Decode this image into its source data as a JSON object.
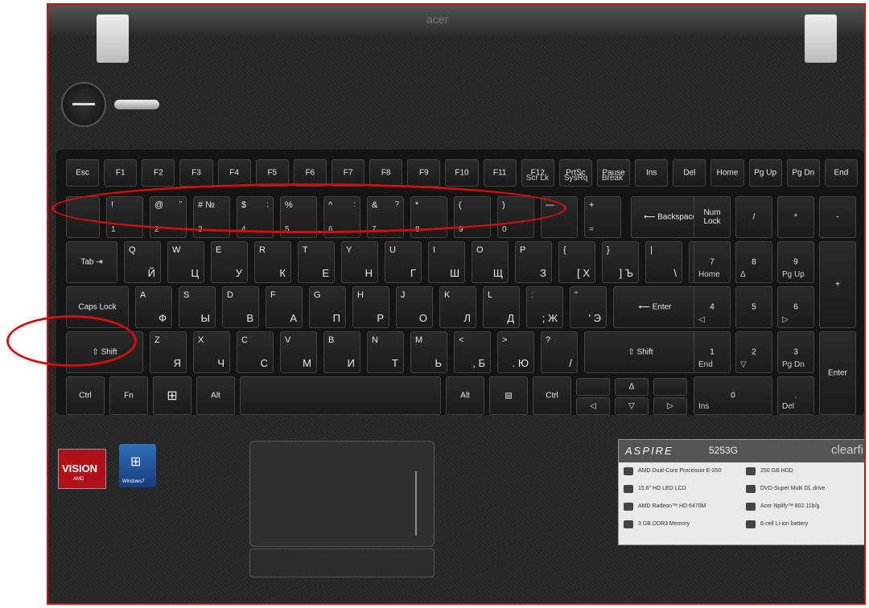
{
  "brand": "acer",
  "keyboard": {
    "fn_row": [
      "Esc",
      "F1",
      "F2",
      "F3",
      "F4",
      "F5",
      "F6",
      "F7",
      "F8",
      "F9",
      "F10",
      "F11",
      "F12",
      "PrtSc",
      "Pause",
      "Ins",
      "Del",
      "Home",
      "Pg Up",
      "Pg Dn",
      "End"
    ],
    "fn_sub": {
      "f12": "Scr Lk",
      "prtsc": "SysRq",
      "pause": "Break"
    },
    "num_row": [
      {
        "p": "!",
        "s": "1"
      },
      {
        "p": "@",
        "t": "\"",
        "s": "2"
      },
      {
        "p": "# №",
        "s": "3"
      },
      {
        "p": "$",
        "t": ";",
        "s": "4"
      },
      {
        "p": "%",
        "s": "5"
      },
      {
        "p": "^",
        "t": ":",
        "s": "6"
      },
      {
        "p": "&",
        "t": "?",
        "s": "7"
      },
      {
        "p": "*",
        "s": "8"
      },
      {
        "p": "(",
        "s": "9"
      },
      {
        "p": ")",
        "s": "0"
      },
      {
        "p": "—",
        "s": ""
      },
      {
        "p": "+",
        "s": "="
      }
    ],
    "backspace": "Backspace",
    "num_lock": "Num Lock",
    "row_q": [
      {
        "p": "Q",
        "c": "Й"
      },
      {
        "p": "W",
        "c": "Ц"
      },
      {
        "p": "E",
        "c": "У"
      },
      {
        "p": "R",
        "c": "К"
      },
      {
        "p": "T",
        "c": "Е"
      },
      {
        "p": "Y",
        "c": "Н"
      },
      {
        "p": "U",
        "c": "Г"
      },
      {
        "p": "I",
        "c": "Ш"
      },
      {
        "p": "O",
        "c": "Щ"
      },
      {
        "p": "P",
        "c": "З"
      },
      {
        "p": "{",
        "c": "[ Х"
      },
      {
        "p": "}",
        "c": "] Ъ"
      },
      {
        "p": "|",
        "c": "\\"
      },
      {
        "p": "/",
        "c": "\\"
      }
    ],
    "row_a": [
      {
        "p": "A",
        "c": "Ф"
      },
      {
        "p": "S",
        "c": "Ы"
      },
      {
        "p": "D",
        "c": "В"
      },
      {
        "p": "F",
        "c": "А"
      },
      {
        "p": "G",
        "c": "П"
      },
      {
        "p": "H",
        "c": "Р"
      },
      {
        "p": "J",
        "c": "О"
      },
      {
        "p": "K",
        "c": "Л"
      },
      {
        "p": "L",
        "c": "Д"
      },
      {
        "p": ":",
        "c": "; Ж"
      },
      {
        "p": "\"",
        "c": "' Э"
      }
    ],
    "row_z": [
      {
        "p": "Z",
        "c": "Я"
      },
      {
        "p": "X",
        "c": "Ч"
      },
      {
        "p": "C",
        "c": "С"
      },
      {
        "p": "V",
        "c": "М"
      },
      {
        "p": "B",
        "c": "И"
      },
      {
        "p": "N",
        "c": "Т"
      },
      {
        "p": "M",
        "c": "Ь"
      },
      {
        "p": "<",
        "c": ", Б"
      },
      {
        "p": ">",
        "c": ". Ю"
      },
      {
        "p": "?",
        "c": "/"
      }
    ],
    "tab": "Tab",
    "caps": "Caps Lock",
    "enter": "Enter",
    "shift_l": "⇧ Shift",
    "shift_r": "⇧ Shift",
    "ctrl": "Ctrl",
    "fn": "Fn",
    "alt": "Alt",
    "numpad": {
      "slash": "/",
      "star": "*",
      "minus": "-",
      "plus": "+",
      "n7": "7",
      "n7s": "Home",
      "n8": "8",
      "n8s": "Δ",
      "n9": "9",
      "n9s": "Pg Up",
      "n4": "4",
      "n4s": "◁",
      "n5": "5",
      "n6": "6",
      "n6s": "▷",
      "n1": "1",
      "n1s": "End",
      "n2": "2",
      "n2s": "▽",
      "n3": "3",
      "n3s": "Pg Dn",
      "n0": "0",
      "n0s": "Ins",
      "dot": ".",
      "dots": "Del",
      "enter": "Enter"
    },
    "arrows": {
      "up": "Δ",
      "left": "◁",
      "down": "▽",
      "right": "▷"
    }
  },
  "stickers": {
    "vision": "VISION",
    "vision_sub": "AMD",
    "windows": "Windows7",
    "aspire": "ASPIRE",
    "model": "5253G",
    "clear": "clearfi",
    "specs": [
      "AMD Dual-Core Processor E-350",
      "250 GB HDD",
      "15.6\" HD LED LCD",
      "DVD-Super Multi DL drive",
      "AMD Radeon™ HD 6470M",
      "Acer Nplify™ 802.11b/g",
      "3 GB DDR3 Memory",
      "6-cell Li-ion battery"
    ]
  },
  "colors": {
    "annotation": "#d01010",
    "body": "#2b2b2b"
  }
}
